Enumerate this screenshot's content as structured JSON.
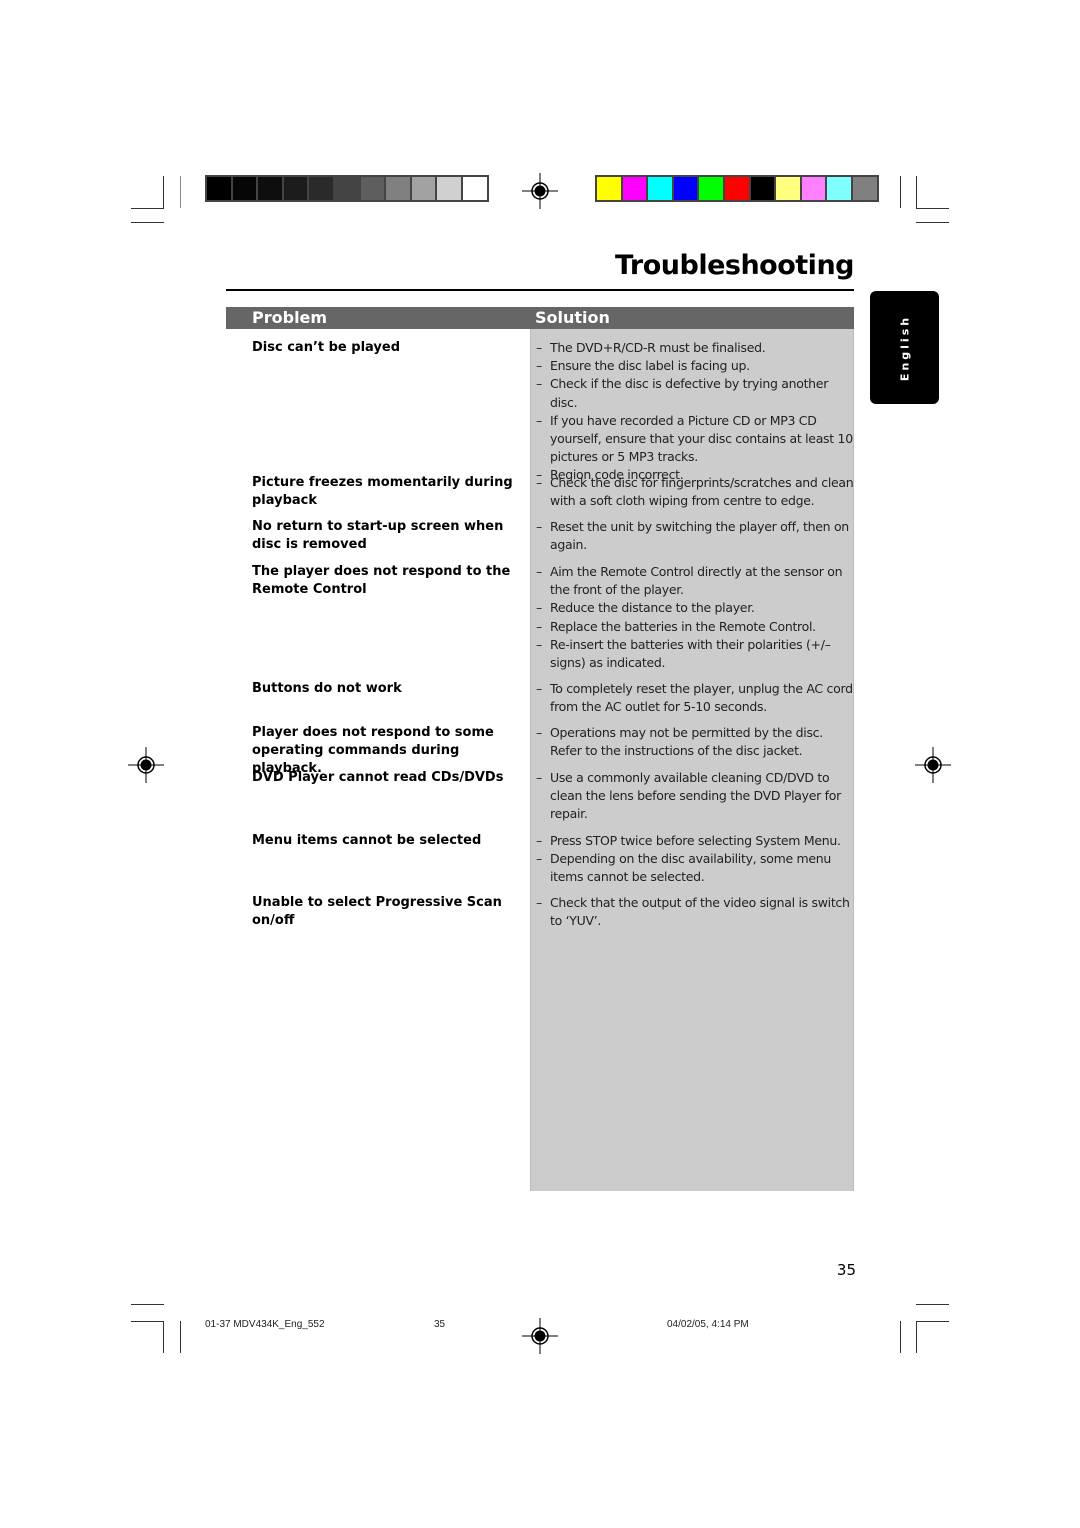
{
  "page": {
    "title": "Troubleshooting",
    "language_tab": "English",
    "page_number": "35"
  },
  "color_bars": {
    "grayscale": [
      "#000000",
      "#060606",
      "#0e0e0e",
      "#1c1c1c",
      "#2a2a2a",
      "#444444",
      "#5e5e5e",
      "#808080",
      "#a2a2a2",
      "#d0d0d0",
      "#ffffff"
    ],
    "colors": [
      "#ffff00",
      "#ff00ff",
      "#00ffff",
      "#0000ff",
      "#00ff00",
      "#ff0000",
      "#000000",
      "#ffff80",
      "#ff80ff",
      "#80ffff",
      "#808080"
    ]
  },
  "table": {
    "header_problem": "Problem",
    "header_solution": "Solution",
    "rows": [
      {
        "problem": "Disc can’t be played",
        "solutions": [
          "The DVD+R/CD-R must be finalised.",
          "Ensure the disc label is facing up.",
          "Check if the disc is defective by trying another disc.",
          "If you have recorded a Picture CD or MP3 CD yourself, ensure that your disc contains at least 10 pictures or 5 MP3 tracks.",
          "Region code incorrect."
        ]
      },
      {
        "problem": "Picture freezes momentarily during playback",
        "solutions": [
          "Check the disc for fingerprints/scratches and clean with a soft cloth wiping from centre to edge."
        ]
      },
      {
        "problem": "No return to start-up screen when disc is removed",
        "solutions": [
          "Reset the unit by switching the player off, then on again."
        ]
      },
      {
        "problem": "The player does not respond to the Remote Control",
        "solutions": [
          "Aim the Remote Control directly at the sensor on the front of the player.",
          "Reduce the distance to the player.",
          "Replace the batteries in the Remote Control.",
          "Re-insert the batteries with their polarities (+/– signs) as indicated."
        ]
      },
      {
        "problem": "Buttons do not work",
        "solutions": [
          "To completely reset the player, unplug the AC cord from the AC outlet for 5-10 seconds."
        ]
      },
      {
        "problem": "Player does not respond to some operating commands during playback.",
        "solutions": [
          "Operations may not be permitted by the disc. Refer to the instructions of  the disc jacket."
        ]
      },
      {
        "problem": "DVD Player cannot read CDs/DVDs",
        "solutions": [
          "Use a commonly available cleaning CD/DVD to clean the lens before sending the DVD Player for repair."
        ]
      },
      {
        "problem": "Menu items cannot be selected",
        "solutions": [
          "Press STOP twice before selecting System Menu.",
          "Depending on the disc availability, some menu items cannot be selected."
        ]
      },
      {
        "problem": "Unable to select Progressive Scan on/off",
        "solutions": [
          "Check that the output of the video signal is switch to ‘YUV’."
        ]
      }
    ]
  },
  "footer": {
    "file": "01-37 MDV434K_Eng_552",
    "page": "35",
    "datetime": "04/02/05, 4:14 PM"
  }
}
